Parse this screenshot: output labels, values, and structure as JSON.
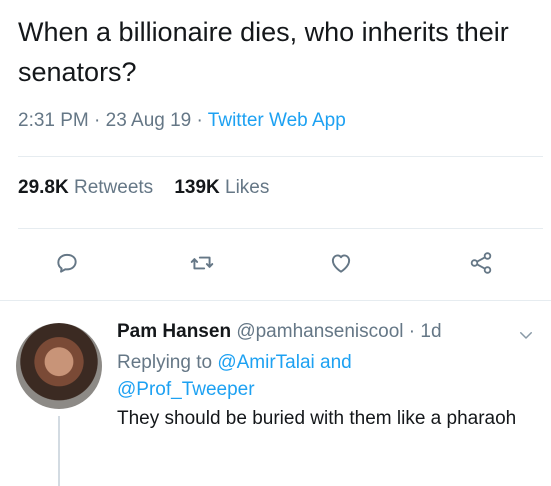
{
  "tweet": {
    "text": "When a billionaire dies, who inherits their senators?",
    "time": "2:31 PM",
    "dot1": " · ",
    "date": "23 Aug 19",
    "dot2": " · ",
    "source": "Twitter Web App"
  },
  "stats": {
    "retweets_count": "29.8K",
    "retweets_label": "Retweets",
    "likes_count": "139K",
    "likes_label": "Likes"
  },
  "actions": {
    "reply_icon": "comment-icon",
    "retweet_icon": "retweet-icon",
    "like_icon": "heart-icon",
    "share_icon": "share-icon"
  },
  "reply": {
    "name": "Pam Hansen",
    "handle": "@pamhanseniscool",
    "dot": " · ",
    "age": "1d",
    "replying_prefix": "Replying to",
    "mention1": "@AmirTalai",
    "and": "and",
    "mention2": "@Prof_Tweeper",
    "text": "They should be buried with them like a pharaoh"
  },
  "colors": {
    "text": "#14171a",
    "secondary": "#657786",
    "link": "#1da1f2",
    "divider": "#e6ecf0"
  }
}
